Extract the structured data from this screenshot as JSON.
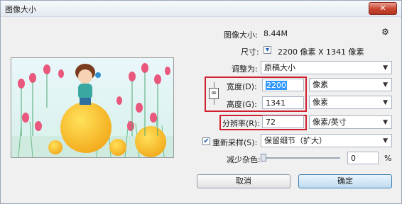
{
  "window": {
    "title": "图像大小",
    "close_label": "✕"
  },
  "image_size": {
    "label": "图像大小:",
    "value": "8.44M"
  },
  "dimensions": {
    "label": "尺寸:",
    "value": "2200 像素  X  1341 像素"
  },
  "fit_to": {
    "label": "调整为:",
    "value": "原稿大小"
  },
  "width": {
    "label": "宽度(D):",
    "value": "2200",
    "unit": "像素"
  },
  "height": {
    "label": "高度(G):",
    "value": "1341",
    "unit": "像素"
  },
  "resolution": {
    "label": "分辨率(R):",
    "value": "72",
    "unit": "像素/英寸"
  },
  "resample": {
    "label": "重新采样(S):",
    "checked": true,
    "value": "保留细节（扩大）"
  },
  "noise": {
    "label": "减少杂色:",
    "value": "0",
    "unit": "%",
    "level": 0
  },
  "buttons": {
    "cancel": "取消",
    "ok": "确定"
  },
  "icons": {
    "gear": "gear-icon",
    "chain": "chain-link-icon",
    "dropdown": "chevron-down-icon"
  }
}
